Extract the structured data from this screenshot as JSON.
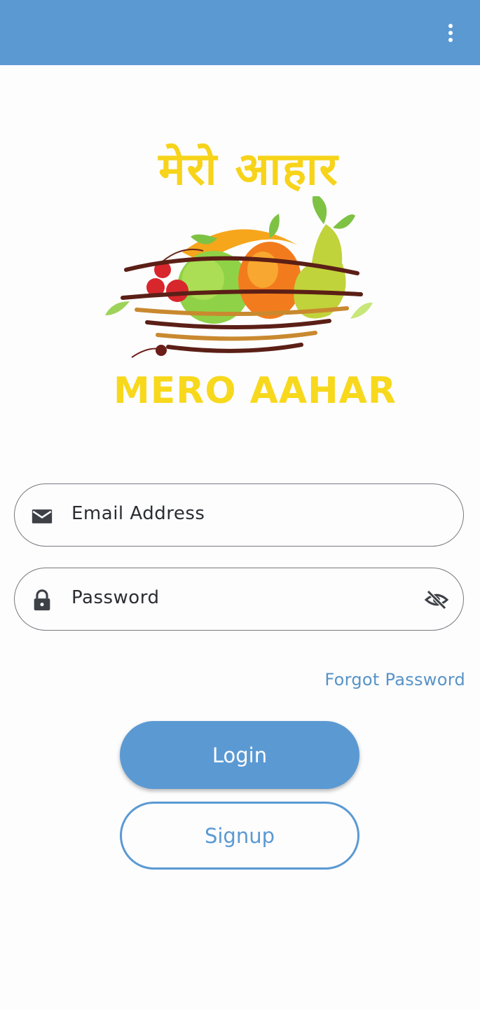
{
  "app_bar": {
    "background_color": "#5b99d3",
    "menu_icon": "more-vertical-icon"
  },
  "logo": {
    "hindi_text": "मेरो आहार",
    "english_text": "MERO AAHAR",
    "text_color": "#f8d81c",
    "art": "fruit-basket-illustration"
  },
  "form": {
    "email": {
      "placeholder": "Email Address",
      "value": "",
      "icon": "email-icon"
    },
    "password": {
      "placeholder": "Password",
      "value": "",
      "icon": "lock-icon",
      "toggle_icon": "visibility-off-icon"
    },
    "forgot_password_label": "Forgot Password"
  },
  "actions": {
    "login_label": "Login",
    "signup_label": "Signup",
    "primary_color": "#5b99d3"
  }
}
